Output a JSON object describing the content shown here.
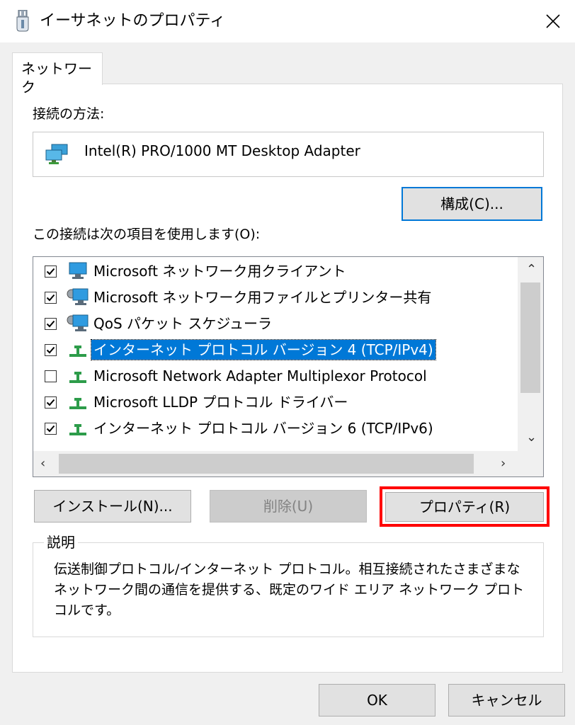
{
  "window": {
    "title": "イーサネットのプロパティ",
    "icon": "network-adapter-icon"
  },
  "tab": {
    "label": "ネットワーク"
  },
  "connection": {
    "label": "接続の方法:",
    "adapter_name": "Intel(R) PRO/1000 MT Desktop Adapter",
    "configure_button": "構成(C)..."
  },
  "items_section": {
    "label": "この接続は次の項目を使用します(O):",
    "items": [
      {
        "label": "Microsoft ネットワーク用クライアント",
        "checked": true,
        "icon": "monitor-icon"
      },
      {
        "label": "Microsoft ネットワーク用ファイルとプリンター共有",
        "checked": true,
        "icon": "monitor-gear-icon"
      },
      {
        "label": "QoS パケット スケジューラ",
        "checked": true,
        "icon": "monitor-gear-icon"
      },
      {
        "label": "インターネット プロトコル バージョン 4 (TCP/IPv4)",
        "checked": true,
        "icon": "protocol-icon",
        "selected": true
      },
      {
        "label": "Microsoft Network Adapter Multiplexor Protocol",
        "checked": false,
        "icon": "protocol-icon"
      },
      {
        "label": "Microsoft LLDP プロトコル ドライバー",
        "checked": true,
        "icon": "protocol-icon"
      },
      {
        "label": "インターネット プロトコル バージョン 6 (TCP/IPv6)",
        "checked": true,
        "icon": "protocol-icon"
      }
    ]
  },
  "buttons": {
    "install": "インストール(N)...",
    "uninstall": "削除(U)",
    "properties": "プロパティ(R)",
    "ok": "OK",
    "cancel": "キャンセル"
  },
  "description": {
    "title": "説明",
    "text": "伝送制御プロトコル/インターネット プロトコル。相互接続されたさまざまなネットワーク間の通信を提供する、既定のワイド エリア ネットワーク プロトコルです。"
  },
  "colors": {
    "selection": "#0078d7",
    "highlight_frame": "#ff0000",
    "focus_border": "#0078d7"
  }
}
